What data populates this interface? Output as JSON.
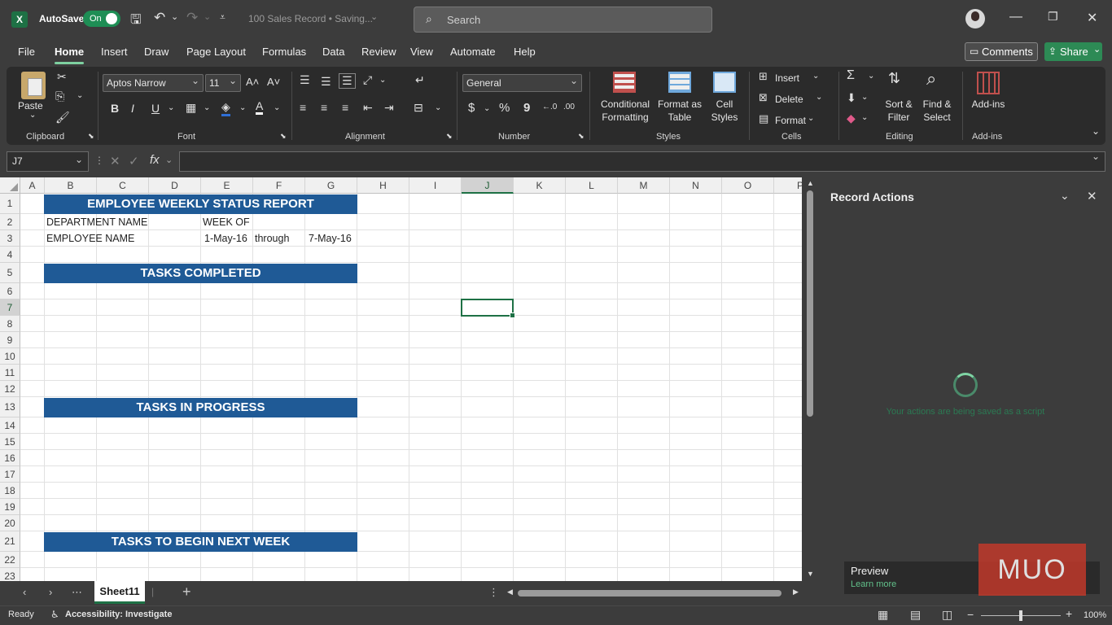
{
  "titlebar": {
    "autosave_label": "AutoSave",
    "autosave_state": "On",
    "doc_title": "100 Sales Record • Saving...",
    "search_placeholder": "Search"
  },
  "menu": {
    "tabs": [
      "File",
      "Home",
      "Insert",
      "Draw",
      "Page Layout",
      "Formulas",
      "Data",
      "Review",
      "View",
      "Automate",
      "Help"
    ],
    "active": "Home",
    "comments_label": "Comments",
    "share_label": "Share"
  },
  "ribbon": {
    "clipboard": {
      "paste": "Paste",
      "label": "Clipboard"
    },
    "font": {
      "name": "Aptos Narrow",
      "size": "11",
      "label": "Font",
      "bold": "B",
      "italic": "I",
      "underline": "U"
    },
    "alignment": {
      "label": "Alignment"
    },
    "number": {
      "format": "General",
      "label": "Number",
      "currency": "$",
      "percent": "%",
      "comma": "9"
    },
    "styles": {
      "conditional_1": "Conditional",
      "conditional_2": "Formatting",
      "format_table_1": "Format as",
      "format_table_2": "Table",
      "cell_styles_1": "Cell",
      "cell_styles_2": "Styles",
      "label": "Styles"
    },
    "cells": {
      "insert": "Insert",
      "delete": "Delete",
      "format": "Format",
      "label": "Cells"
    },
    "editing": {
      "sort_1": "Sort &",
      "sort_2": "Filter",
      "find_1": "Find &",
      "find_2": "Select",
      "label": "Editing"
    },
    "addins": {
      "button": "Add-ins",
      "label": "Add-ins"
    }
  },
  "formula_bar": {
    "name_box": "J7",
    "formula": ""
  },
  "sheet": {
    "columns": [
      "A",
      "B",
      "C",
      "D",
      "E",
      "F",
      "G",
      "H",
      "I",
      "J",
      "K",
      "L",
      "M",
      "N",
      "O",
      "P"
    ],
    "active_column": "J",
    "active_row": "7",
    "rows": [
      "1",
      "2",
      "3",
      "4",
      "5",
      "6",
      "7",
      "8",
      "9",
      "10",
      "11",
      "12",
      "13",
      "14",
      "15",
      "16",
      "17",
      "18",
      "19",
      "20",
      "21",
      "22",
      "23"
    ],
    "title": "EMPLOYEE WEEKLY STATUS REPORT",
    "department_label": "DEPARTMENT NAME",
    "week_of_label": "WEEK OF",
    "employee_label": "EMPLOYEE NAME",
    "start_date": "1-May-16",
    "through": "through",
    "end_date": "7-May-16",
    "tasks_completed": "TASKS COMPLETED",
    "tasks_in_progress": "TASKS IN PROGRESS",
    "tasks_next_week": "TASKS TO BEGIN NEXT WEEK"
  },
  "side_panel": {
    "title": "Record Actions",
    "status": "Your actions are being saved as a script",
    "preview_title": "Preview",
    "preview_link": "Learn more",
    "watermark": "MUO"
  },
  "tabs_bar": {
    "sheet_name": "Sheet11"
  },
  "status_bar": {
    "mode": "Ready",
    "accessibility": "Accessibility: Investigate",
    "zoom": "100%"
  }
}
